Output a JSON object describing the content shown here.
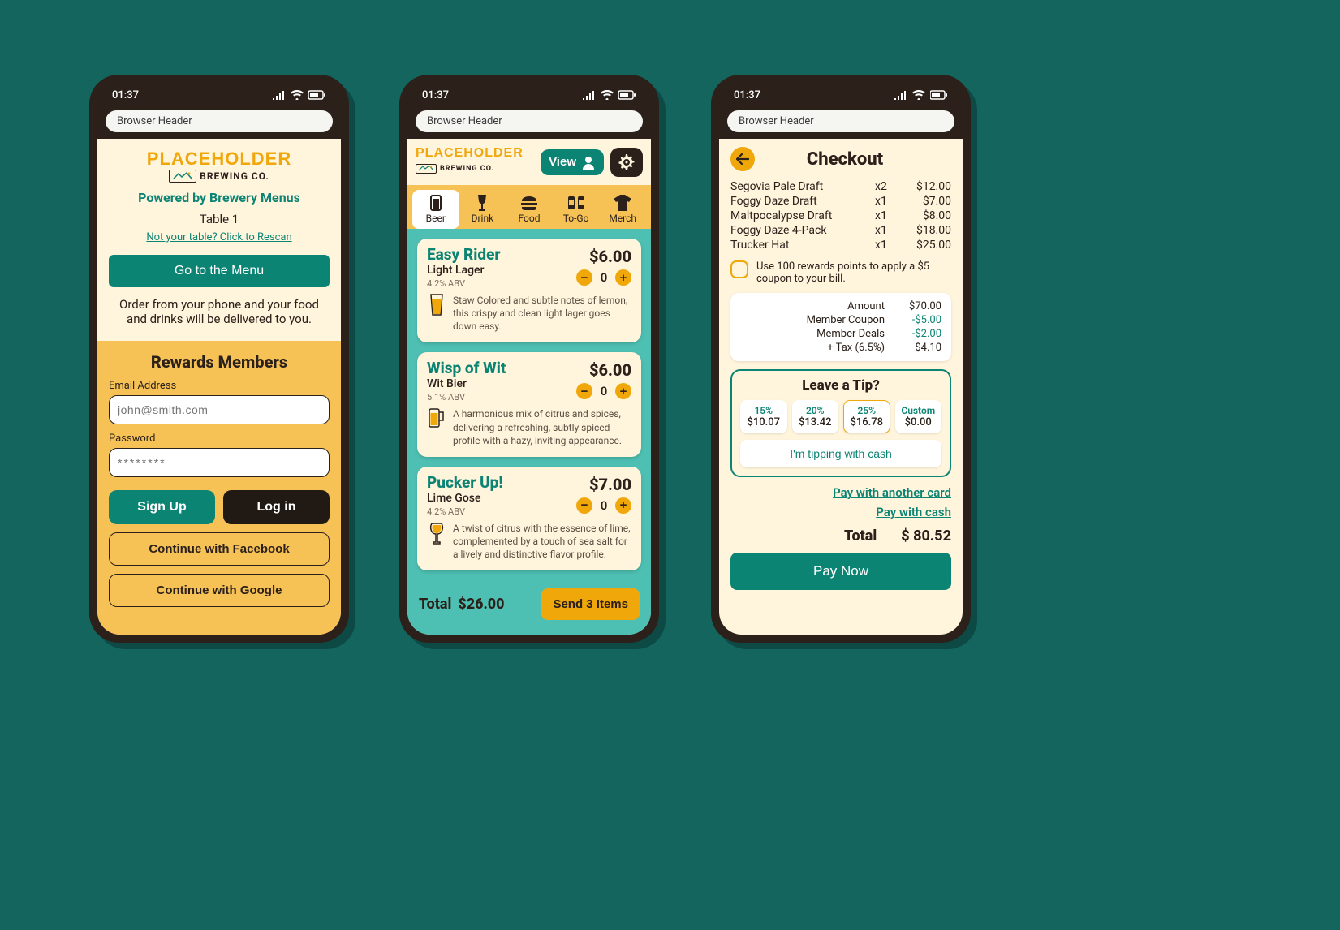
{
  "status": {
    "time": "01:37"
  },
  "browser_header": "Browser Header",
  "logo": {
    "line1": "PLACEHOLDER",
    "line2": "BREWING CO."
  },
  "screen1": {
    "powered": "Powered by Brewery Menus",
    "table": "Table 1",
    "rescan": "Not your table? Click to Rescan",
    "menu_btn": "Go to the Menu",
    "order_from": "Order from your phone and your food and drinks will be delivered to you.",
    "rewards_title": "Rewards Members",
    "email_label": "Email Address",
    "email_placeholder": "john@smith.com",
    "password_label": "Password",
    "password_placeholder": "********",
    "signup": "Sign Up",
    "login": "Log in",
    "facebook": "Continue with Facebook",
    "google": "Continue with Google"
  },
  "screen2": {
    "view_btn": "View",
    "tabs": [
      {
        "label": "Beer",
        "icon": "beer-icon"
      },
      {
        "label": "Drink",
        "icon": "wine-icon"
      },
      {
        "label": "Food",
        "icon": "burger-icon"
      },
      {
        "label": "To-Go",
        "icon": "cans-icon"
      },
      {
        "label": "Merch",
        "icon": "shirt-icon"
      }
    ],
    "active_tab": "Beer",
    "items": [
      {
        "name": "Easy Rider",
        "style": "Light Lager",
        "abv": "4.2% ABV",
        "price": "$6.00",
        "qty": "0",
        "desc": "Staw Colored and subtle notes of lemon, this crispy and clean light lager goes down easy."
      },
      {
        "name": "Wisp of Wit",
        "style": "Wit Bier",
        "abv": "5.1% ABV",
        "price": "$6.00",
        "qty": "0",
        "desc": "A harmonious mix of citrus and spices, delivering a refreshing, subtly spiced profile with a hazy, inviting appearance."
      },
      {
        "name": "Pucker Up!",
        "style": "Lime Gose",
        "abv": "4.2% ABV",
        "price": "$7.00",
        "qty": "0",
        "desc": "A twist of citrus with the essence of lime, complemented by a touch of sea salt for a lively and distinctive flavor profile."
      }
    ],
    "footer_total_label": "Total",
    "footer_total_value": "$26.00",
    "send_btn": "Send 3 Items"
  },
  "screen3": {
    "title": "Checkout",
    "lines": [
      {
        "name": "Segovia Pale Draft",
        "qty": "x2",
        "price": "$12.00"
      },
      {
        "name": "Foggy Daze Draft",
        "qty": "x1",
        "price": "$7.00"
      },
      {
        "name": "Maltpocalypse Draft",
        "qty": "x1",
        "price": "$8.00"
      },
      {
        "name": "Foggy Daze 4-Pack",
        "qty": "x1",
        "price": "$18.00"
      },
      {
        "name": "Trucker Hat",
        "qty": "x1",
        "price": "$25.00"
      }
    ],
    "coupon_text": "Use 100 rewards points to apply a $5 coupon to your bill.",
    "summary": [
      {
        "label": "Amount",
        "value": "$70.00",
        "neg": false
      },
      {
        "label": "Member Coupon",
        "value": "-$5.00",
        "neg": true
      },
      {
        "label": "Member Deals",
        "value": "-$2.00",
        "neg": true
      },
      {
        "label": "+ Tax (6.5%)",
        "value": "$4.10",
        "neg": false
      }
    ],
    "tip_title": "Leave a Tip?",
    "tips": [
      {
        "pct": "15%",
        "amt": "$10.07",
        "selected": false
      },
      {
        "pct": "20%",
        "amt": "$13.42",
        "selected": false
      },
      {
        "pct": "25%",
        "amt": "$16.78",
        "selected": true
      },
      {
        "pct": "Custom",
        "amt": "$0.00",
        "selected": false
      }
    ],
    "cash_tip": "I'm tipping with cash",
    "alt_card": "Pay with another card",
    "alt_cash": "Pay with cash",
    "total_label": "Total",
    "total_value": "$ 80.52",
    "pay_now": "Pay Now"
  }
}
